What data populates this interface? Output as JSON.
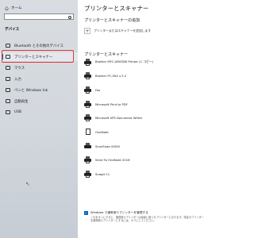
{
  "sidebar": {
    "home_label": "ホーム",
    "section_label": "デバイス",
    "items": [
      {
        "label": "Bluetooth とその他のデバイス",
        "icon": "bluetooth-icon"
      },
      {
        "label": "プリンターとスキャナー",
        "icon": "printer-icon",
        "active": true
      },
      {
        "label": "マウス",
        "icon": "mouse-icon"
      },
      {
        "label": "入力",
        "icon": "keyboard-icon"
      },
      {
        "label": "ペンと Windows Ink",
        "icon": "pen-icon"
      },
      {
        "label": "自動再生",
        "icon": "autoplay-icon"
      },
      {
        "label": "USB",
        "icon": "usb-icon"
      }
    ]
  },
  "main": {
    "title": "プリンターとスキャナー",
    "add_section": "プリンターとスキャナーの追加",
    "add_button": "プリンターまたはスキャナーを追加します",
    "list_section": "プリンターとスキャナー",
    "printers": [
      "Brother MFC-J893DW Printer (1 コピー)",
      "Brother PC-FAX v.3.2",
      "Fax",
      "Microsoft Print to PDF",
      "Microsoft XPS Document Writer",
      "OneNote",
      "ScanSnap iX500",
      "Send To OneNote 2016",
      "Snagit 11"
    ],
    "checkbox_label": "Windows で通常使うプリンターを管理する",
    "checkbox_checked": true,
    "note": "これをオンにすると、通常使うプリンターは最後に使ったプリンターになります。特定のプリンターを通常使うプリンターにするには、オフにしてください。"
  },
  "colors": {
    "accent": "#0067c0",
    "highlight": "#e0383a"
  }
}
